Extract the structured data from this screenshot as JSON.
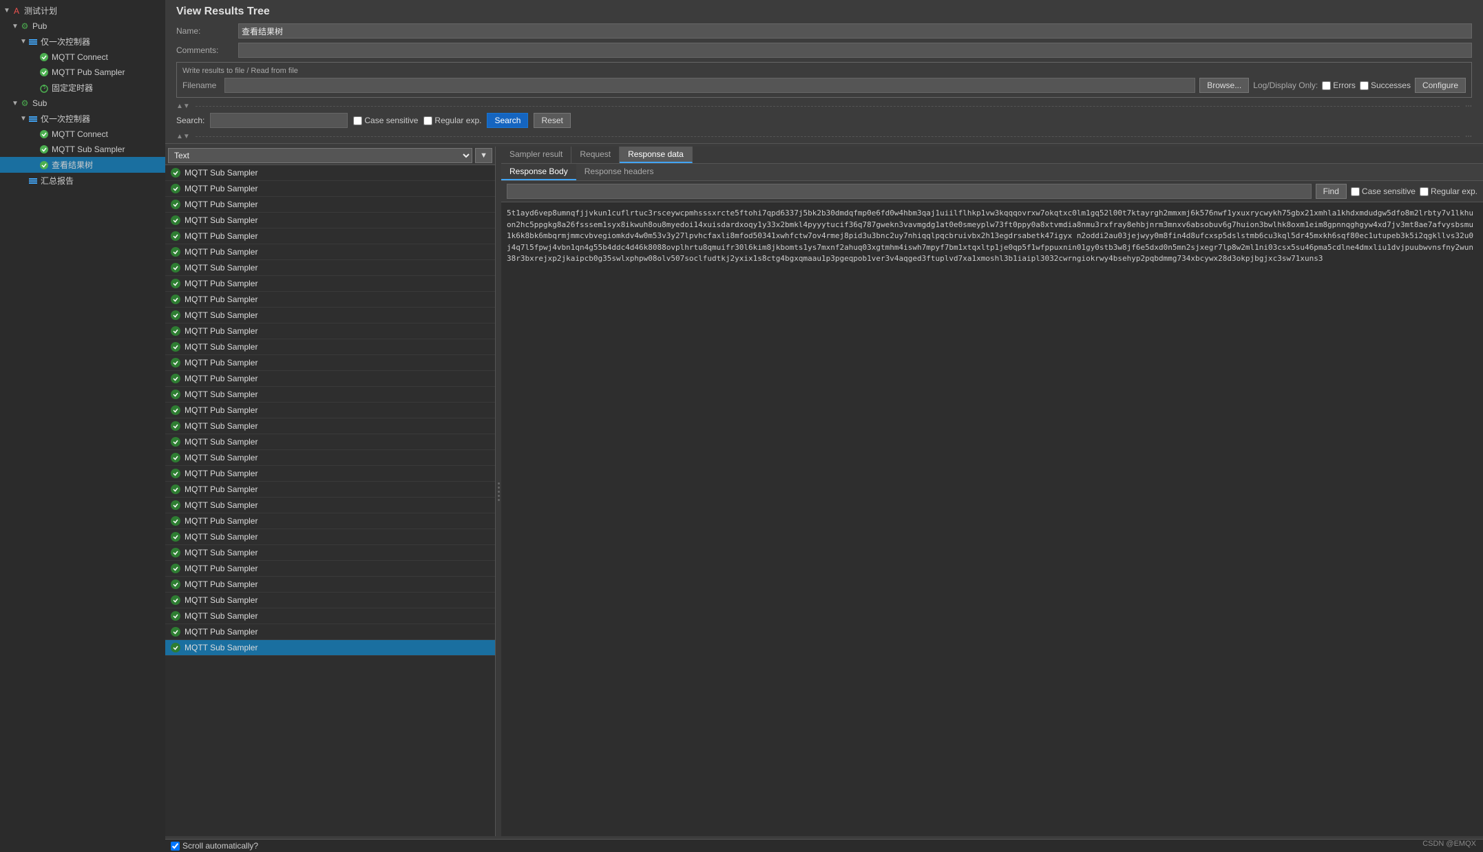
{
  "app": {
    "title": "View Results Tree"
  },
  "sidebar": {
    "items": [
      {
        "id": "test-plan",
        "label": "测试计划",
        "indent": 0,
        "arrow": "▼",
        "icon": "A",
        "icon_type": "red",
        "level": 0
      },
      {
        "id": "pub",
        "label": "Pub",
        "indent": 1,
        "arrow": "▼",
        "icon": "⚙",
        "icon_type": "green",
        "level": 1
      },
      {
        "id": "controller1",
        "label": "仅一次控制器",
        "indent": 2,
        "arrow": "▼",
        "icon": "≡",
        "icon_type": "blue",
        "level": 2
      },
      {
        "id": "mqtt-connect1",
        "label": "MQTT Connect",
        "indent": 3,
        "arrow": "",
        "icon": "✓",
        "icon_type": "green",
        "level": 3
      },
      {
        "id": "mqtt-pub-sampler",
        "label": "MQTT Pub Sampler",
        "indent": 3,
        "arrow": "",
        "icon": "✓",
        "icon_type": "green",
        "level": 3
      },
      {
        "id": "timer1",
        "label": "固定定时器",
        "indent": 3,
        "arrow": "",
        "icon": "⏱",
        "icon_type": "green",
        "level": 3
      },
      {
        "id": "sub",
        "label": "Sub",
        "indent": 1,
        "arrow": "▼",
        "icon": "⚙",
        "icon_type": "green",
        "level": 1
      },
      {
        "id": "controller2",
        "label": "仅一次控制器",
        "indent": 2,
        "arrow": "▼",
        "icon": "≡",
        "icon_type": "blue",
        "level": 2
      },
      {
        "id": "mqtt-connect2",
        "label": "MQTT Connect",
        "indent": 3,
        "arrow": "",
        "icon": "✓",
        "icon_type": "green",
        "level": 3
      },
      {
        "id": "mqtt-sub-sampler",
        "label": "MQTT Sub Sampler",
        "indent": 3,
        "arrow": "",
        "icon": "✓",
        "icon_type": "green",
        "level": 3
      },
      {
        "id": "view-results",
        "label": "查看结果树",
        "indent": 3,
        "arrow": "",
        "icon": "✓",
        "icon_type": "green",
        "level": 3,
        "selected": true
      },
      {
        "id": "summary",
        "label": "汇总报告",
        "indent": 2,
        "arrow": "",
        "icon": "≡",
        "icon_type": "blue",
        "level": 2
      }
    ]
  },
  "main": {
    "title": "View Results Tree",
    "name_label": "Name:",
    "name_value": "查看结果树",
    "comments_label": "Comments:",
    "write_results": {
      "title": "Write results to file / Read from file",
      "filename_label": "Filename",
      "filename_value": "",
      "browse_label": "Browse...",
      "log_display_label": "Log/Display Only:",
      "errors_label": "Errors",
      "successes_label": "Successes",
      "configure_label": "Configure"
    },
    "search": {
      "label": "Search:",
      "placeholder": "",
      "case_sensitive": "Case sensitive",
      "regular_exp": "Regular exp.",
      "search_btn": "Search",
      "reset_btn": "Reset"
    }
  },
  "results_list": {
    "filter": "Text",
    "items": [
      {
        "name": "MQTT Sub Sampler",
        "status": "success"
      },
      {
        "name": "MQTT Pub Sampler",
        "status": "success"
      },
      {
        "name": "MQTT Pub Sampler",
        "status": "success"
      },
      {
        "name": "MQTT Sub Sampler",
        "status": "success"
      },
      {
        "name": "MQTT Pub Sampler",
        "status": "success"
      },
      {
        "name": "MQTT Pub Sampler",
        "status": "success"
      },
      {
        "name": "MQTT Sub Sampler",
        "status": "success"
      },
      {
        "name": "MQTT Pub Sampler",
        "status": "success"
      },
      {
        "name": "MQTT Pub Sampler",
        "status": "success"
      },
      {
        "name": "MQTT Sub Sampler",
        "status": "success"
      },
      {
        "name": "MQTT Pub Sampler",
        "status": "success"
      },
      {
        "name": "MQTT Sub Sampler",
        "status": "success"
      },
      {
        "name": "MQTT Pub Sampler",
        "status": "success"
      },
      {
        "name": "MQTT Pub Sampler",
        "status": "success"
      },
      {
        "name": "MQTT Sub Sampler",
        "status": "success"
      },
      {
        "name": "MQTT Pub Sampler",
        "status": "success"
      },
      {
        "name": "MQTT Sub Sampler",
        "status": "success"
      },
      {
        "name": "MQTT Sub Sampler",
        "status": "success"
      },
      {
        "name": "MQTT Sub Sampler",
        "status": "success"
      },
      {
        "name": "MQTT Pub Sampler",
        "status": "success"
      },
      {
        "name": "MQTT Pub Sampler",
        "status": "success"
      },
      {
        "name": "MQTT Sub Sampler",
        "status": "success"
      },
      {
        "name": "MQTT Pub Sampler",
        "status": "success"
      },
      {
        "name": "MQTT Sub Sampler",
        "status": "success"
      },
      {
        "name": "MQTT Sub Sampler",
        "status": "success"
      },
      {
        "name": "MQTT Pub Sampler",
        "status": "success"
      },
      {
        "name": "MQTT Pub Sampler",
        "status": "success"
      },
      {
        "name": "MQTT Sub Sampler",
        "status": "success"
      },
      {
        "name": "MQTT Sub Sampler",
        "status": "success"
      },
      {
        "name": "MQTT Pub Sampler",
        "status": "success"
      },
      {
        "name": "MQTT Sub Sampler",
        "status": "selected"
      }
    ]
  },
  "detail_panel": {
    "tabs": [
      {
        "id": "sampler-result",
        "label": "Sampler result"
      },
      {
        "id": "request",
        "label": "Request"
      },
      {
        "id": "response-data",
        "label": "Response data",
        "active": true
      }
    ],
    "sub_tabs": [
      {
        "id": "response-body",
        "label": "Response Body",
        "active": true
      },
      {
        "id": "response-headers",
        "label": "Response headers"
      }
    ],
    "find_label": "Find",
    "case_sensitive": "Case sensitive",
    "regular_exp": "Regular exp.",
    "response_body": "5t1ayd6vep8umnqfjjvkun1cuflrtuc3rsceywcpmhsssxrcte5ftohi7qpd6337j5bk2b30dmdqfmp0e6fd0w4hbm3qaj1uiilflhkp1vw3kqqqovrxw7okqtxc0lm1gq52l00t7ktayrgh2mmxmj6k576nwf1yxuxrycwykh75gbx21xmhla1khdxmdudgw5dfo8m2lrbty7v1lkhuon2hc5ppgkg8a26fsssem1syx8ikwuh8ou8myedoi14xuisdardxoqy1y33x2bmkl4pyyytucif36q787gwekn3vavmgdg1at0e0smeyplw73ft0ppy0a8xtvmdia8nmu3rxfray8ehbjnrm3mnxv6absobuv6g7huion3bwlhk8oxm1eim8gpnnqghgyw4xd7jv3mt8ae7afvysbsmu1k6k8bk6mbqrmjmmcvbvegiomkdv4w0m53v3y27lpvhcfaxli8mfod50341xwhfctw7ov4rmej8pid3u3bnc2uy7nhiqqlpqcbruivbx2h13egdrsabetk47igyx n2oddi2au03jejwyy0m8fin4d8ufcxsp5dslstmb6cu3kql5dr45mxkh6sqf80ec1utupeb3k5i2qgkllvs32u0j4q7l5fpwj4vbn1qn4g55b4ddc4d46k8088ovplhrtu8qmuifr30l6kim8jkbomts1ys7mxnf2ahuq03xgtmhm4iswh7mpyf7bm1xtqxltp1je0qp5f1wfppuxnin01gy0stb3w8jf6e5dxd0n5mn2sjxegr7lp8w2ml1ni03csx5su46pma5cdlne4dmxliu1dvjpuubwvnsfny2wun38r3bxrejxp2jkaipcb0g35swlxphpw08olv507soclfudtkj2yxix1s8ctg4bgxqmaau1p3pgeqpob1ver3v4aqged3ftuplvd7xa1xmoshl3b1iaipl3032cwrngiokrwy4bsehyp2pqbdmmg734xbcywx28d3okpjbgjxc3sw71xuns3"
  },
  "bottom_bar": {
    "scroll_auto_label": "Scroll automatically?"
  },
  "watermark": "CSDN @EMQX"
}
